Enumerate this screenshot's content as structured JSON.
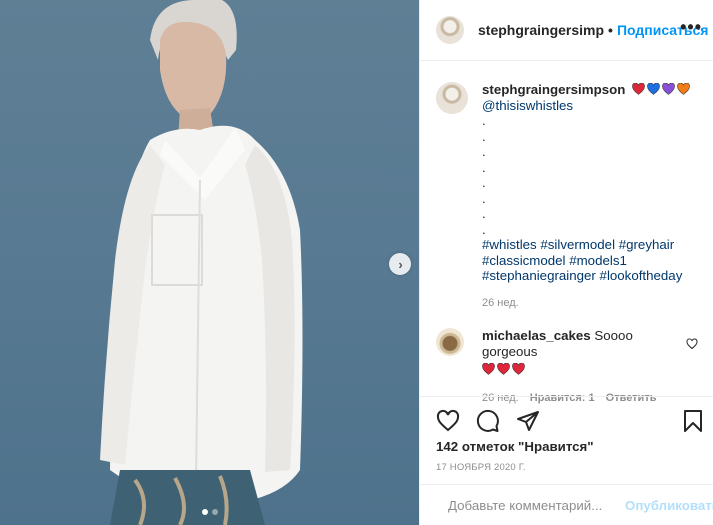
{
  "post": {
    "image_alt": "",
    "carousel": {
      "count": 2,
      "active": 0,
      "next_icon": "chevron-right-icon"
    }
  },
  "header": {
    "username": "stephgraingersimp",
    "separator": "•",
    "follow_label": "Подписаться",
    "more_icon": "ellipsis-icon",
    "more_label": "•••"
  },
  "caption": {
    "username": "stephgraingersimpson",
    "hearts": [
      "#e0263a",
      "#1e6fe0",
      "#8a4fd8",
      "#f07d1a"
    ],
    "mention": "@thisiswhistles",
    "dots": [
      ".",
      ".",
      ".",
      ".",
      ".",
      ".",
      ".",
      "."
    ],
    "hashtags": [
      "#whistles #silvermodel #greyhair",
      "#classicmodel #models1",
      "#stephaniegrainger #lookoftheday"
    ],
    "time": "26 нед."
  },
  "comment": {
    "username": "michaelas_cakes",
    "text": "Soooo gorgeous",
    "hearts": [
      "#e0263a",
      "#e0263a",
      "#e0263a"
    ],
    "time": "26 нед.",
    "likes": "Нравится: 1",
    "reply": "Ответить"
  },
  "actions": {
    "like_icon": "heart-icon",
    "comment_icon": "comment-icon",
    "share_icon": "share-icon",
    "save_icon": "bookmark-icon",
    "likes_text": "142 отметок \"Нравится\"",
    "date": "17 НОЯБРЯ 2020 Г."
  },
  "add_comment": {
    "emoji_icon": "smiley-icon",
    "placeholder": "Добавьте комментарий...",
    "publish_label": "Опубликовать"
  },
  "colors": {
    "accent": "#0095f6",
    "publish_disabled": "#b2dffc",
    "link": "#00376b",
    "backdrop": "#587a92"
  }
}
